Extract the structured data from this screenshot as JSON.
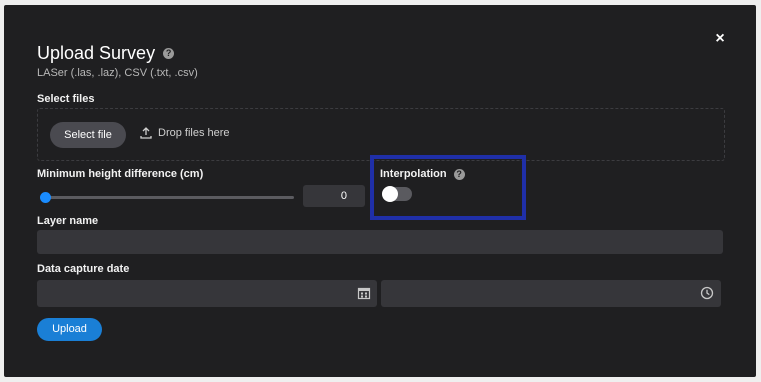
{
  "dialog": {
    "title": "Upload Survey",
    "subtitle": "LASer (.las, .laz), CSV (.txt, .csv)",
    "close_label": "×"
  },
  "files": {
    "label": "Select files",
    "select_button": "Select file",
    "drop_hint": "Drop files here"
  },
  "height_diff": {
    "label": "Minimum height difference (cm)",
    "value": "0",
    "slider_value": 0
  },
  "interpolation": {
    "label": "Interpolation",
    "enabled": false
  },
  "layer_name": {
    "label": "Layer name",
    "value": ""
  },
  "capture_date": {
    "label": "Data capture date",
    "date_value": "",
    "time_value": ""
  },
  "actions": {
    "upload_label": "Upload"
  },
  "colors": {
    "accent": "#1a7fd6",
    "highlight": "#1f2fa8"
  }
}
